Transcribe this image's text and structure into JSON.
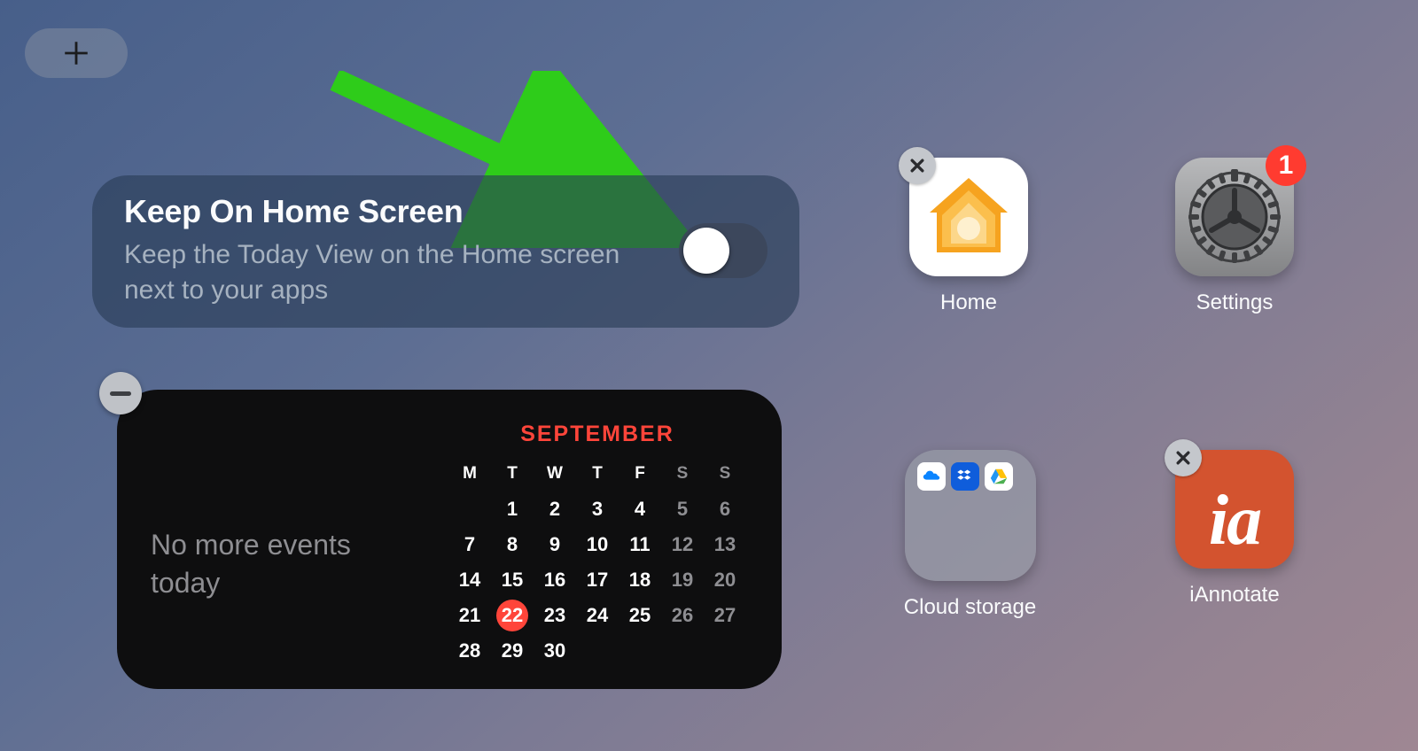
{
  "addButton": {
    "glyph": "+"
  },
  "keepCard": {
    "title": "Keep On Home Screen",
    "description": "Keep the Today View on the Home screen next to your apps",
    "toggled": false
  },
  "calendarWidget": {
    "message": "No more events today",
    "month": "SEPTEMBER",
    "headers": [
      "M",
      "T",
      "W",
      "T",
      "F",
      "S",
      "S"
    ],
    "weeks": [
      [
        "",
        "1",
        "2",
        "3",
        "4",
        "5",
        "6"
      ],
      [
        "7",
        "8",
        "9",
        "10",
        "11",
        "12",
        "13"
      ],
      [
        "14",
        "15",
        "16",
        "17",
        "18",
        "19",
        "20"
      ],
      [
        "21",
        "22",
        "23",
        "24",
        "25",
        "26",
        "27"
      ],
      [
        "28",
        "29",
        "30",
        "",
        "",
        "",
        ""
      ]
    ],
    "today": "22",
    "weekendCols": [
      5,
      6
    ]
  },
  "apps": {
    "home": {
      "label": "Home",
      "icon": "home-house-icon"
    },
    "settings": {
      "label": "Settings",
      "icon": "gear-icon",
      "badge": "1"
    },
    "cloud": {
      "label": "Cloud storage",
      "icon": "folder-icon"
    },
    "iannotate": {
      "label": "iAnnotate",
      "icon": "ia-icon",
      "iaGlyph": "ia"
    }
  },
  "annotationArrow": {
    "color": "#2ecc1a"
  }
}
